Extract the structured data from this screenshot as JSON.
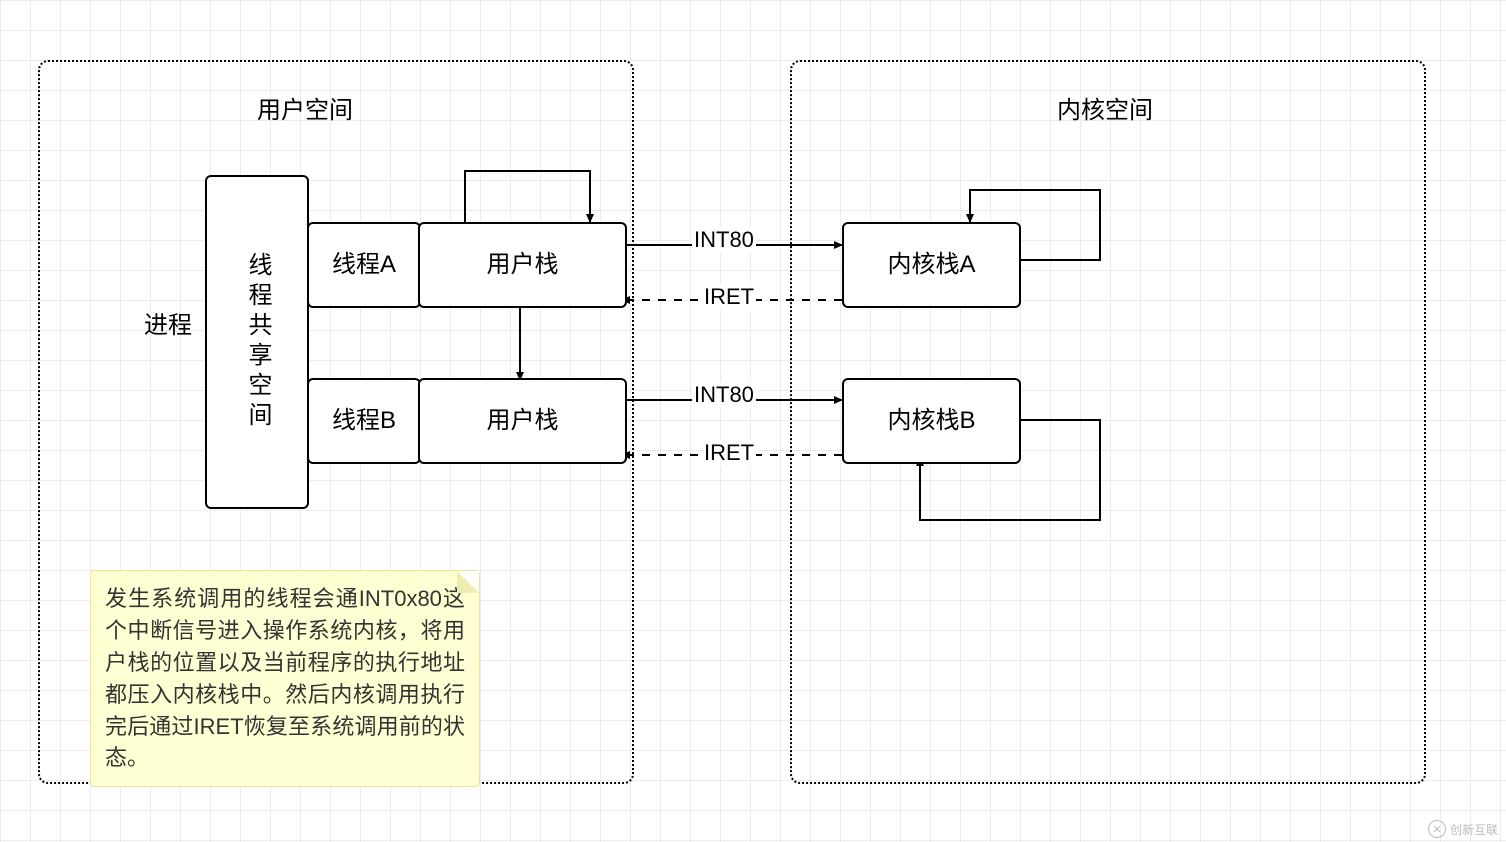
{
  "diagram": {
    "user_space_title": "用户空间",
    "kernel_space_title": "内核空间",
    "process_label": "进程",
    "thread_shared_label": "线程共享空间",
    "thread_a": "线程A",
    "thread_b": "线程B",
    "user_stack": "用户栈",
    "kernel_stack_a": "内核栈A",
    "kernel_stack_b": "内核栈B",
    "int80": "INT80",
    "iret": "IRET",
    "note_text": "发生系统调用的线程会通INT0x80这个中断信号进入操作系统内核，将用户栈的位置以及当前程序的执行地址都压入内核栈中。然后内核调用执行完后通过IRET恢复至系统调用前的状态。"
  },
  "watermark": {
    "text": "创新互联",
    "icon": "✕"
  }
}
